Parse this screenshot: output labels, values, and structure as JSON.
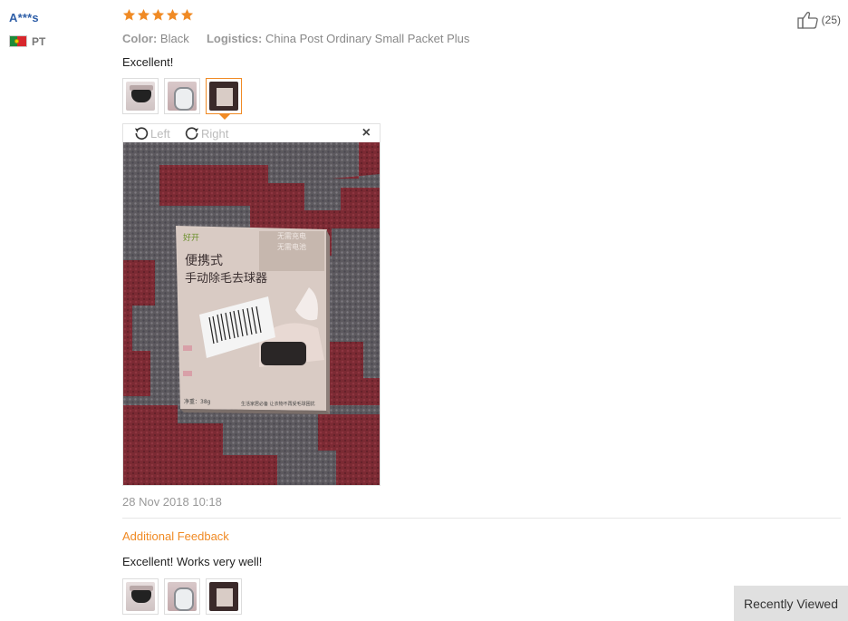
{
  "reviewer": {
    "name": "A***s",
    "country": "PT"
  },
  "rating": {
    "stars": 5
  },
  "meta": {
    "color_label": "Color:",
    "color_value": "Black",
    "logistics_label": "Logistics:",
    "logistics_value": "China Post Ordinary Small Packet Plus"
  },
  "review": {
    "text": "Excellent!"
  },
  "viewer": {
    "rotate_left": "Left",
    "rotate_right": "Right",
    "close": "×"
  },
  "photo_text": {
    "brand": "好开",
    "line1": "便携式",
    "line2": "手动除毛去球器",
    "corner1": "无需充电",
    "corner2": "无需电池",
    "weight": "净重：38g",
    "footer": "生活家居必备 让衣物不再受毛球困扰"
  },
  "timestamp": "28 Nov 2018 10:18",
  "additional_feedback": {
    "label": "Additional Feedback",
    "text": "Excellent! Works very well!"
  },
  "helpful": {
    "count": "(25)"
  },
  "recently_viewed": {
    "label": "Recently Viewed"
  },
  "colors": {
    "accent": "#f08a24",
    "link": "#2f5fa8",
    "star": "#f08a24"
  }
}
